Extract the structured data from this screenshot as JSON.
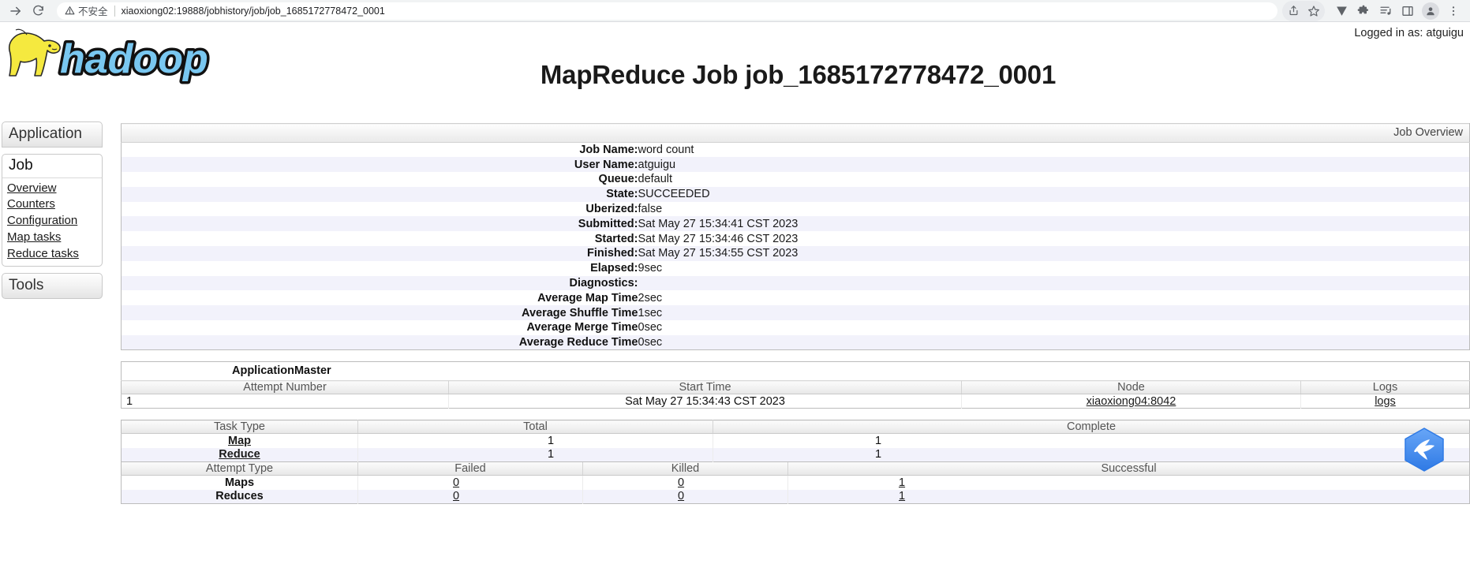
{
  "browser": {
    "reload_icon": "reload-icon",
    "forward_icon": "forward-arrow-icon",
    "security_label": "不安全",
    "url": "xiaoxiong02:19888/jobhistory/job/job_1685172778472_0001",
    "toolbar_icons": [
      "share-icon",
      "bookmark-star-icon",
      "vimium-v-icon",
      "extensions-puzzle-icon",
      "media-list-icon",
      "side-panel-icon",
      "profile-avatar-icon",
      "chrome-menu-icon"
    ]
  },
  "header": {
    "logo_alt": "hadoop-logo",
    "logo_text": "hadoop",
    "title": "MapReduce Job job_1685172778472_0001",
    "logged_in_as": "Logged in as: atguigu"
  },
  "sidebar": {
    "application_label": "Application",
    "job_label": "Job",
    "job_links": [
      {
        "label": "Overview"
      },
      {
        "label": "Counters"
      },
      {
        "label": "Configuration"
      },
      {
        "label": "Map tasks"
      },
      {
        "label": "Reduce tasks"
      }
    ],
    "tools_label": "Tools"
  },
  "job_overview": {
    "caption": "Job Overview",
    "rows": [
      {
        "key": "Job Name:",
        "value": "word count"
      },
      {
        "key": "User Name:",
        "value": "atguigu"
      },
      {
        "key": "Queue:",
        "value": "default"
      },
      {
        "key": "State:",
        "value": "SUCCEEDED"
      },
      {
        "key": "Uberized:",
        "value": "false"
      },
      {
        "key": "Submitted:",
        "value": "Sat May 27 15:34:41 CST 2023"
      },
      {
        "key": "Started:",
        "value": "Sat May 27 15:34:46 CST 2023"
      },
      {
        "key": "Finished:",
        "value": "Sat May 27 15:34:55 CST 2023"
      },
      {
        "key": "Elapsed:",
        "value": "9sec"
      },
      {
        "key": "Diagnostics:",
        "value": ""
      },
      {
        "key": "Average Map Time",
        "value": "2sec"
      },
      {
        "key": "Average Shuffle Time",
        "value": "1sec"
      },
      {
        "key": "Average Merge Time",
        "value": "0sec"
      },
      {
        "key": "Average Reduce Time",
        "value": "0sec"
      }
    ]
  },
  "application_master": {
    "caption": "ApplicationMaster",
    "columns": [
      "Attempt Number",
      "Start Time",
      "Node",
      "Logs"
    ],
    "rows": [
      {
        "attempt_number": "1",
        "start_time": "Sat May 27 15:34:43 CST 2023",
        "node": "xiaoxiong04:8042",
        "logs": "logs"
      }
    ]
  },
  "task_table": {
    "columns": [
      "Task Type",
      "Total",
      "Complete"
    ],
    "rows": [
      {
        "task_type": "Map",
        "total": "1",
        "complete": "1"
      },
      {
        "task_type": "Reduce",
        "total": "1",
        "complete": "1"
      }
    ]
  },
  "attempt_table": {
    "columns": [
      "Attempt Type",
      "Failed",
      "Killed",
      "Successful"
    ],
    "rows": [
      {
        "attempt_type": "Maps",
        "failed": "0",
        "killed": "0",
        "successful": "1"
      },
      {
        "attempt_type": "Reduces",
        "failed": "0",
        "killed": "0",
        "successful": "1"
      }
    ]
  },
  "overlay": {
    "badge_icon": "bird-hexagon-badge-icon"
  },
  "colors": {
    "alt_row": "#f2f2fb",
    "logo_blue": "#79c7f0",
    "logo_yellow": "#f5e93f",
    "badge_blue": "#3d8bf2"
  }
}
